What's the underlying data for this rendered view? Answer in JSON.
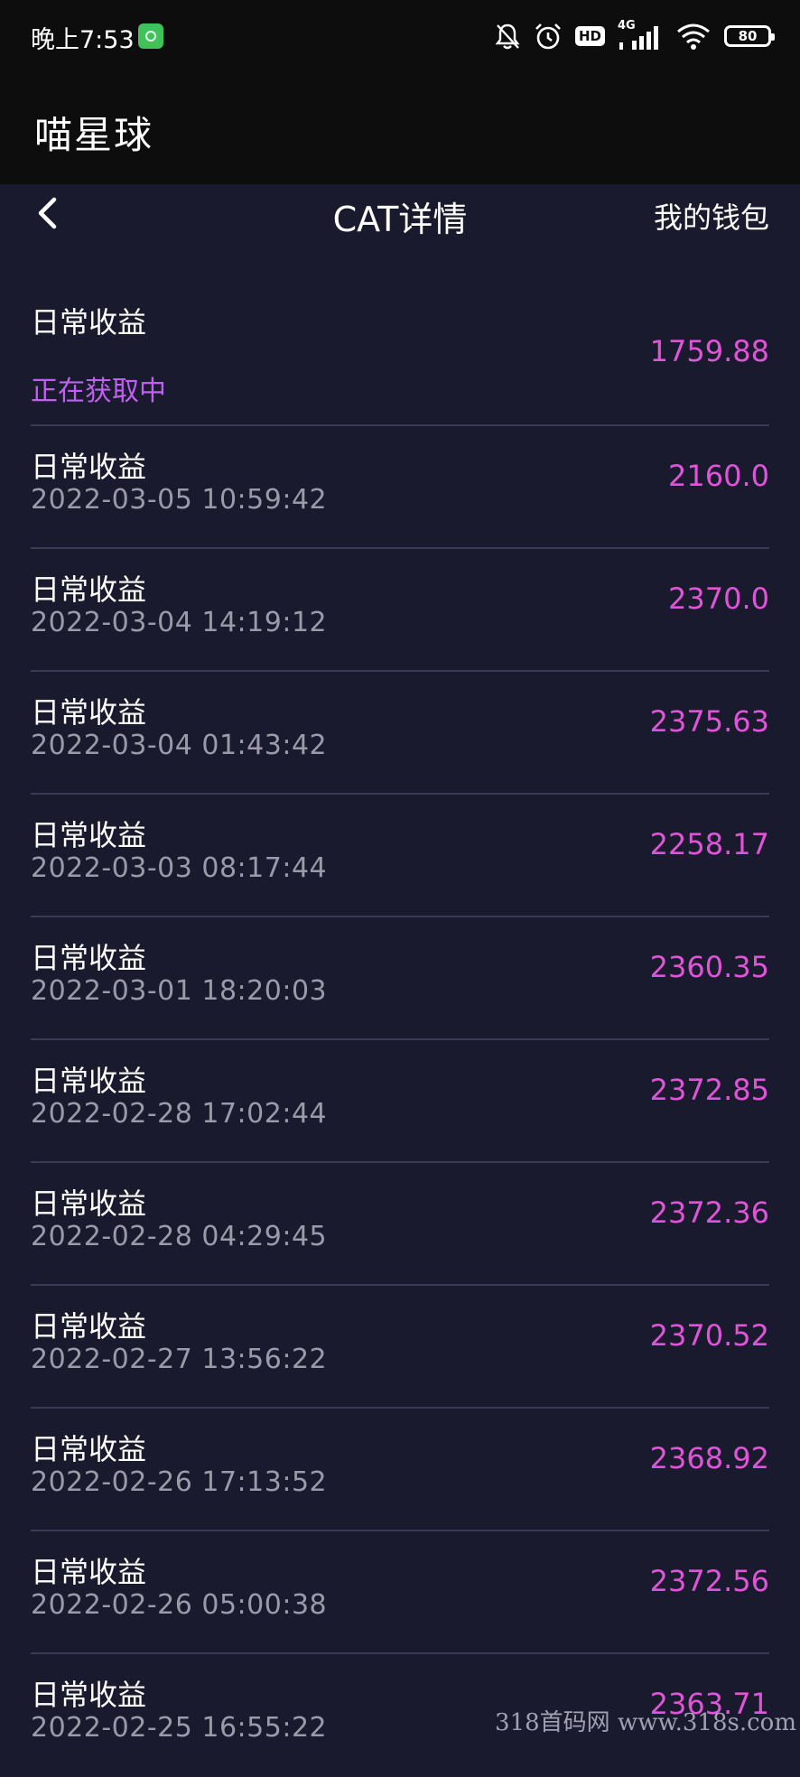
{
  "status_bar": {
    "time": "晚上7:53",
    "hd": "HD",
    "network": "4G",
    "battery": "80"
  },
  "header": {
    "title": "喵星球"
  },
  "nav": {
    "title": "CAT详情",
    "wallet": "我的钱包"
  },
  "records": [
    {
      "label": "日常收益",
      "sub": "正在获取中",
      "amount": "1759.88"
    },
    {
      "label": "日常收益",
      "sub": "2022-03-05 10:59:42",
      "amount": "2160.0"
    },
    {
      "label": "日常收益",
      "sub": "2022-03-04 14:19:12",
      "amount": "2370.0"
    },
    {
      "label": "日常收益",
      "sub": "2022-03-04 01:43:42",
      "amount": "2375.63"
    },
    {
      "label": "日常收益",
      "sub": "2022-03-03 08:17:44",
      "amount": "2258.17"
    },
    {
      "label": "日常收益",
      "sub": "2022-03-01 18:20:03",
      "amount": "2360.35"
    },
    {
      "label": "日常收益",
      "sub": "2022-02-28 17:02:44",
      "amount": "2372.85"
    },
    {
      "label": "日常收益",
      "sub": "2022-02-28 04:29:45",
      "amount": "2372.36"
    },
    {
      "label": "日常收益",
      "sub": "2022-02-27 13:56:22",
      "amount": "2370.52"
    },
    {
      "label": "日常收益",
      "sub": "2022-02-26 17:13:52",
      "amount": "2368.92"
    },
    {
      "label": "日常收益",
      "sub": "2022-02-26 05:00:38",
      "amount": "2372.56"
    },
    {
      "label": "日常收益",
      "sub": "2022-02-25 16:55:22",
      "amount": "2363.71"
    }
  ],
  "watermark": "318首码网 www.318s.com",
  "colors": {
    "background": "#1a1a2e",
    "amount": "#e055d8",
    "pending": "#c060f0",
    "divider": "#3a3a58"
  }
}
